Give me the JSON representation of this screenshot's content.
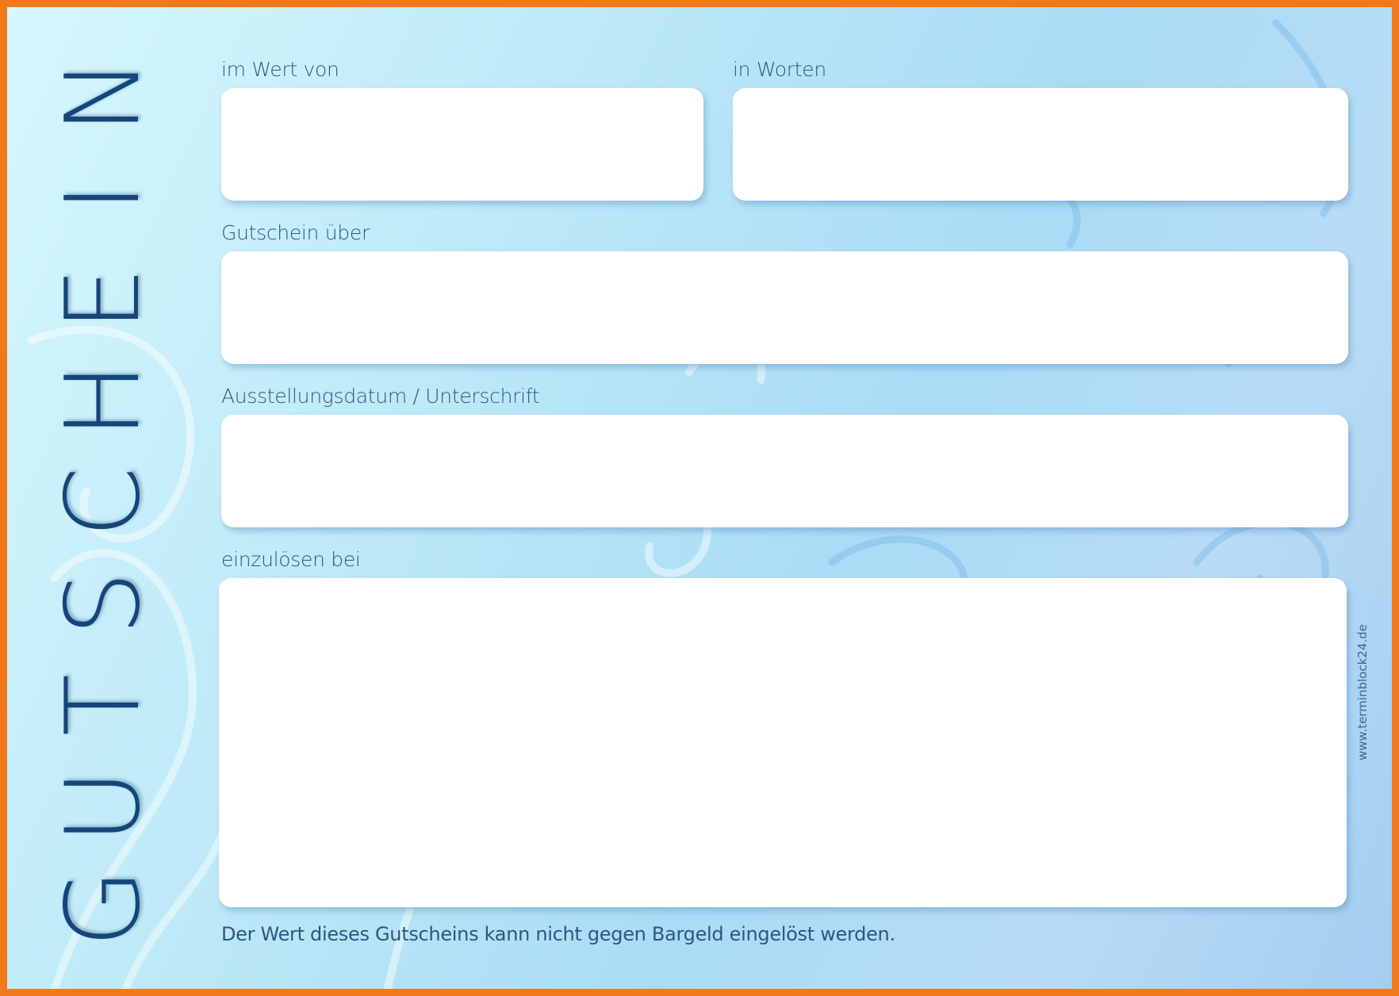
{
  "voucher": {
    "title": "GUTSCHEIN",
    "fields": {
      "value_label": "im Wert von",
      "words_label": "in Worten",
      "about_label": "Gutschein über",
      "date_signature_label": "Ausstellungsdatum / Unterschrift",
      "redeem_label": "einzulösen bei"
    },
    "footnote": "Der Wert dieses Gutscheins kann nicht gegen Bargeld eingelöst werden.",
    "website": "www.terminblock24.de"
  },
  "colors": {
    "border": "#f07a1a",
    "title": "#14467a",
    "label": "#2d5680",
    "background": "#bfeaf8"
  }
}
